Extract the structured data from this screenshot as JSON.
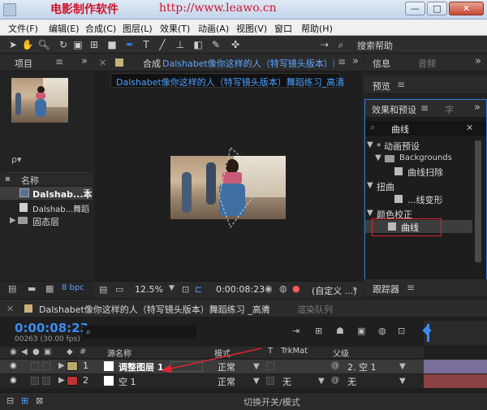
{
  "window": {
    "watermark": "电影制作软件",
    "url": "http://www.leawo.cn",
    "buttons": [
      "—",
      "□",
      "✕"
    ]
  },
  "menubar": [
    "文件(F)",
    "编辑(E)",
    "合成(C)",
    "图层(L)",
    "效果(T)",
    "动画(A)",
    "视图(V)",
    "窗口",
    "帮助(H)"
  ],
  "toolbar": {
    "search_help": "搜索帮助"
  },
  "project_panel": {
    "tab": "项目",
    "search_placeholder": "ρ▾",
    "column_name": "名称",
    "items": [
      {
        "name": "Dalshab...本",
        "type": "comp"
      },
      {
        "name": "Dalshab...舞蹈",
        "type": "footage"
      },
      {
        "name": "固态层",
        "type": "folder"
      }
    ],
    "bpc": "8 bpc"
  },
  "comp_panel": {
    "tab_prefix": "合成",
    "tab_title": "Dalshabet像你这样的人（特写镜头版本）舞蹈",
    "breadcrumb": "Dalshabet像你这样的人（特写镜头版本）舞蹈练习_高清",
    "zoom": "12.5%",
    "timecode": "0:00:08:23",
    "resolution": "(自定义 ...)"
  },
  "right_panel": {
    "info_tab": "信息",
    "audio_tab": "音频",
    "preview_tab": "预览",
    "effects_tab": "效果和预设",
    "char_tab": "字",
    "search_value": "曲线",
    "tree": [
      {
        "label": "* 动画预设",
        "level": 0,
        "expanded": true
      },
      {
        "label": "Backgrounds",
        "level": 1,
        "folder": true
      },
      {
        "label": "曲线扫除",
        "level": 2
      },
      {
        "label": "扭曲",
        "level": 0,
        "expanded": true
      },
      {
        "label": "...线变形",
        "level": 2
      },
      {
        "label": "颜色校正",
        "level": 0,
        "expanded": true
      },
      {
        "label": "曲线",
        "level": 2,
        "highlighted": true
      }
    ],
    "tracker_tab": "跟踪器"
  },
  "timeline": {
    "tab": "Dalshabet像你这样的人（特写镜头版本）舞蹈练习 _高清",
    "render_tab": "渲染队列",
    "timecode": "0:00:08:23",
    "frames": "00263 (30.00 fps)",
    "columns": {
      "num": "#",
      "source": "源名称",
      "mode": "模式",
      "t": "T",
      "trkmat": "TrkMat",
      "parent": "父级"
    },
    "layers": [
      {
        "num": "1",
        "name": "调整图层 1",
        "mode": "正常",
        "trkmat": "",
        "parent": "2. 空 1",
        "color": "#b8a86e"
      },
      {
        "num": "2",
        "name": "空 1",
        "mode": "正常",
        "trkmat": "无",
        "parent": "无",
        "color": "#c03434"
      }
    ],
    "footer": "切换开关/模式"
  },
  "colors": {
    "accent": "#2e8bff",
    "highlight_box": "#e0252f",
    "timecode": "#3b8cf0"
  }
}
